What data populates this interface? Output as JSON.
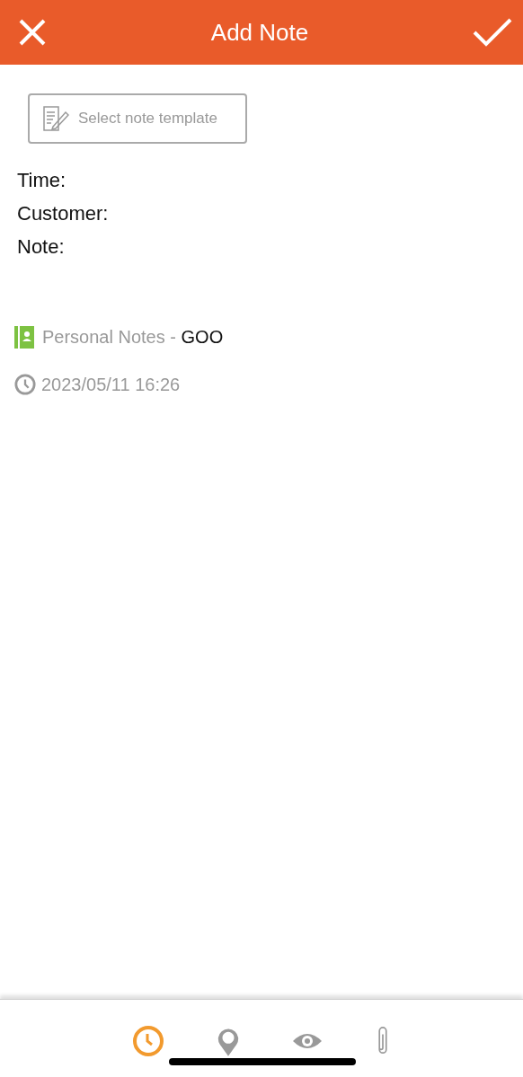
{
  "header": {
    "title": "Add Note"
  },
  "template_button": {
    "label": "Select note template"
  },
  "fields": [
    {
      "label": "Time:"
    },
    {
      "label": "Customer:"
    },
    {
      "label": "Note:"
    }
  ],
  "notebook": {
    "name": "Personal Notes",
    "separator": " - ",
    "owner": "GOO"
  },
  "timestamp": "2023/05/11 16:26",
  "toolbar": [
    {
      "kind": "clock",
      "selected": true
    },
    {
      "kind": "pin",
      "selected": false
    },
    {
      "kind": "eye",
      "selected": false
    },
    {
      "kind": "clip",
      "selected": false
    }
  ]
}
